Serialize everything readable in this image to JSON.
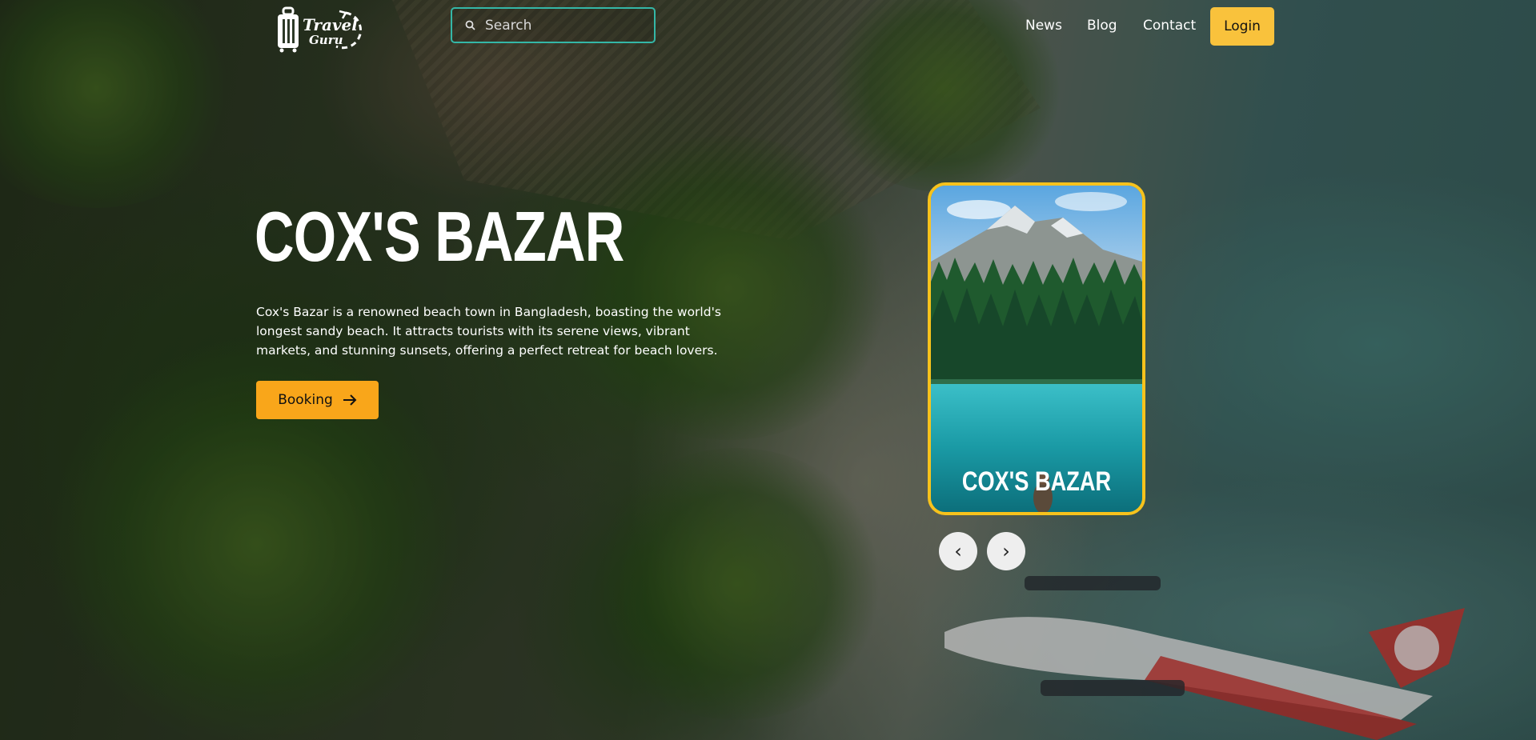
{
  "brand": {
    "logo_line1": "Travel",
    "logo_line2": "Guru",
    "logo_icon": "suitcase-icon"
  },
  "search": {
    "placeholder": "Search",
    "value": "",
    "icon": "search-icon"
  },
  "nav": {
    "items": [
      {
        "label": "News"
      },
      {
        "label": "Blog"
      },
      {
        "label": "Contact"
      }
    ],
    "login_label": "Login"
  },
  "hero": {
    "title": "COX'S BAZAR",
    "description": "Cox's Bazar is a renowned beach town in Bangladesh, boasting the world's longest sandy beach. It attracts tourists with its serene views, vibrant markets, and stunning sunsets, offering a perfect retreat for beach lovers.",
    "booking_label": "Booking",
    "booking_icon": "arrow-right-icon"
  },
  "carousel": {
    "card_title": "COX'S BAZAR",
    "prev_label": "‹",
    "next_label": "›"
  },
  "colors": {
    "accent_yellow": "#f9c23c",
    "booking_orange": "#f9a61a",
    "card_border": "#f7c21c",
    "search_border": "#34b7a7"
  }
}
